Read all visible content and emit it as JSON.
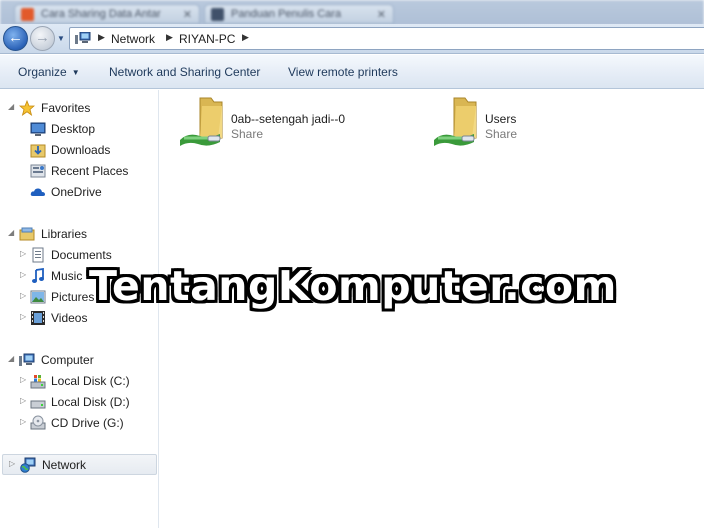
{
  "window": {
    "tabs": [
      {
        "label": "Cara Sharing Data Antar"
      },
      {
        "label": "Panduan Penulis Cara"
      }
    ]
  },
  "navigation": {
    "breadcrumb": [
      "Network",
      "RIYAN-PC"
    ]
  },
  "toolbar": {
    "organize_label": "Organize",
    "network_sharing_label": "Network and Sharing Center",
    "view_printers_label": "View remote printers"
  },
  "sidebar": {
    "favorites": {
      "label": "Favorites",
      "items": [
        {
          "label": "Desktop",
          "icon": "desktop-icon"
        },
        {
          "label": "Downloads",
          "icon": "downloads-icon"
        },
        {
          "label": "Recent Places",
          "icon": "recent-places-icon"
        },
        {
          "label": "OneDrive",
          "icon": "onedrive-icon"
        }
      ]
    },
    "libraries": {
      "label": "Libraries",
      "items": [
        {
          "label": "Documents",
          "icon": "documents-icon"
        },
        {
          "label": "Music",
          "icon": "music-icon"
        },
        {
          "label": "Pictures",
          "icon": "pictures-icon"
        },
        {
          "label": "Videos",
          "icon": "videos-icon"
        }
      ]
    },
    "computer": {
      "label": "Computer",
      "items": [
        {
          "label": "Local Disk (C:)",
          "icon": "windows-disk-icon"
        },
        {
          "label": "Local Disk (D:)",
          "icon": "disk-icon"
        },
        {
          "label": "CD Drive (G:)",
          "icon": "cd-drive-icon"
        }
      ]
    },
    "network": {
      "label": "Network"
    }
  },
  "content": {
    "shares": [
      {
        "name": "0ab--setengah jadi--0",
        "type": "Share"
      },
      {
        "name": "Users",
        "type": "Share"
      }
    ]
  },
  "watermark": {
    "text": "TentangKomputer.com"
  },
  "colors": {
    "accent": "#1e395b",
    "folder": "#e8c96a",
    "network_green": "#3a9a3a"
  }
}
